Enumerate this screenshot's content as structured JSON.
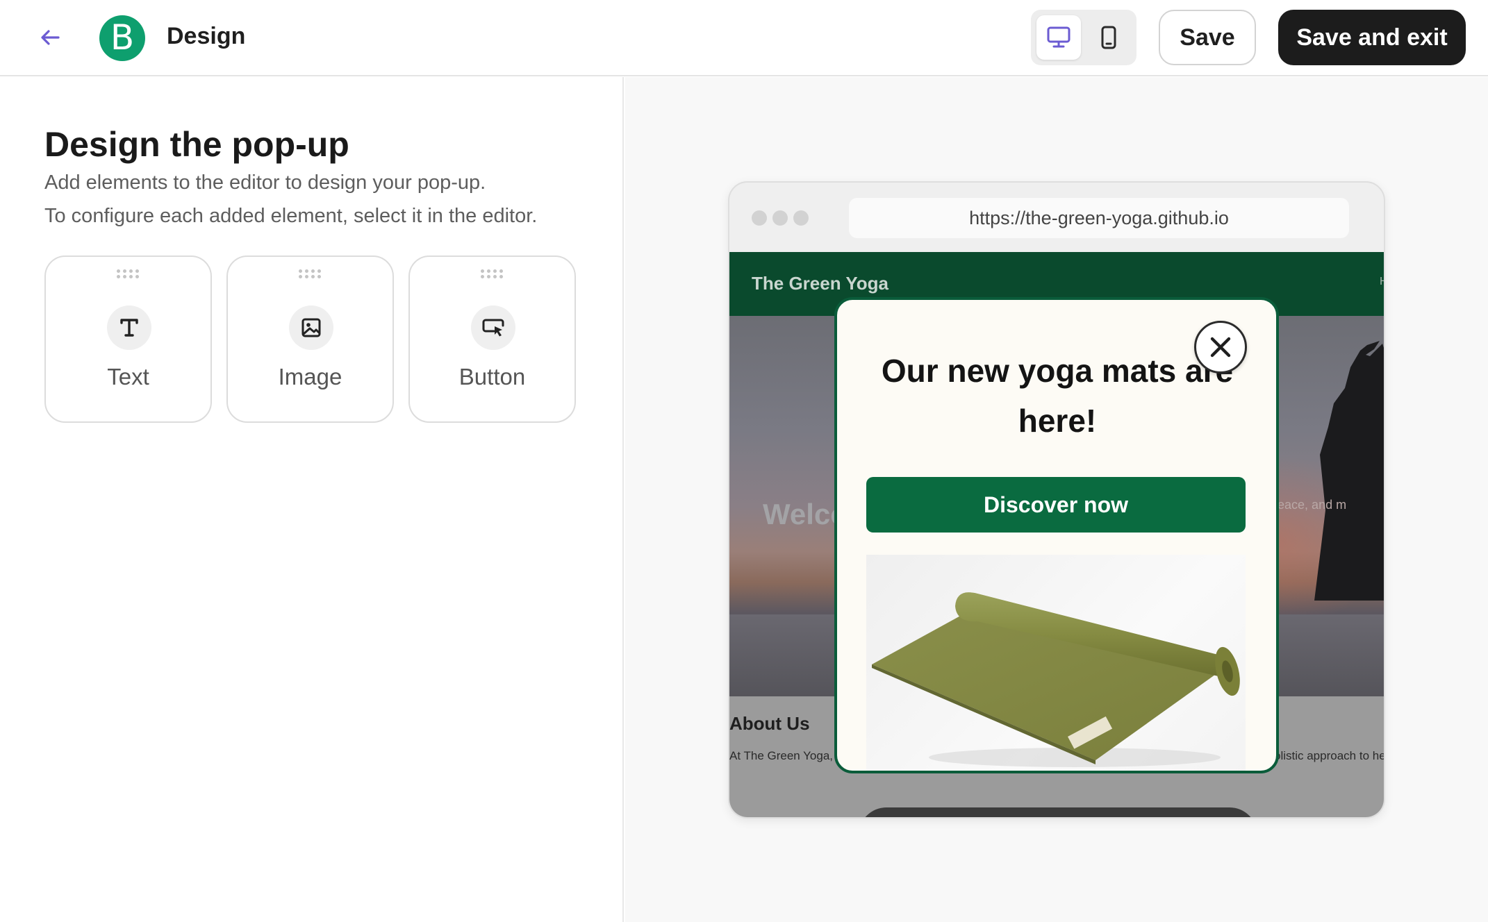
{
  "header": {
    "title": "Design",
    "logo_letter": "B",
    "save_label": "Save",
    "save_exit_label": "Save and exit",
    "device_modes": [
      "desktop",
      "mobile"
    ],
    "selected_device": "desktop",
    "accent_color": "#6b5bd2",
    "logo_color": "#0e9f6e"
  },
  "panel": {
    "title": "Design the pop-up",
    "subtitle_1": "Add elements to the editor to design your pop-up.",
    "subtitle_2": "To configure each added element, select it in the editor.",
    "elements": [
      {
        "label": "Text",
        "icon": "text-icon"
      },
      {
        "label": "Image",
        "icon": "image-icon"
      },
      {
        "label": "Button",
        "icon": "button-cursor-icon"
      }
    ]
  },
  "preview": {
    "url": "https://the-green-yoga.github.io",
    "site": {
      "name": "The Green Yoga",
      "nav_fragment": "H",
      "hero_welcome": "Welco",
      "hero_tagline": "lth, peace, and m",
      "about_title": "About Us",
      "about_text_left": "At The Green Yoga, w",
      "about_text_right": "olistic approach to hea"
    },
    "popup": {
      "heading": "Our new yoga mats are here!",
      "cta_label": "Discover now",
      "brand_color": "#0a6b40",
      "image_icon": "yoga-mat-image"
    }
  }
}
